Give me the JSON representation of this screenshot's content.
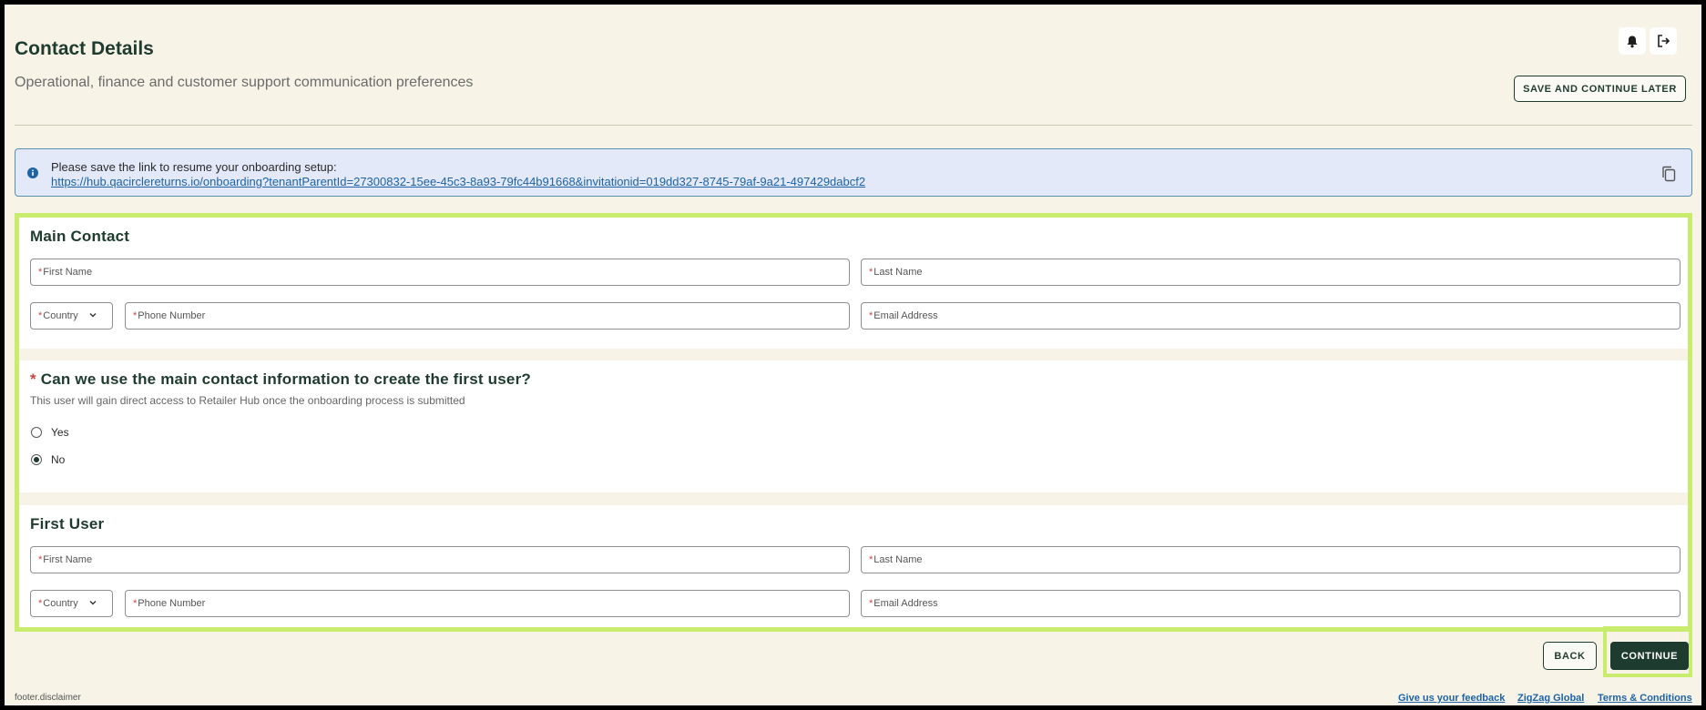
{
  "header": {
    "title": "Contact Details",
    "subtitle": "Operational, finance and customer support communication preferences",
    "save_later_label": "SAVE AND CONTINUE LATER"
  },
  "icons": {
    "notifications": "bell-icon",
    "logout": "logout-icon",
    "info": "info-icon",
    "copy": "copy-icon",
    "dropdown": "chevron-down-icon"
  },
  "banner": {
    "text": "Please save the link to resume your onboarding setup:",
    "link": "https://hub.qacirclereturns.io/onboarding?tenantParentId=27300832-15ee-45c3-8a93-79fc44b91668&invitationid=019dd327-8745-79af-9a21-497429dabcf2"
  },
  "main_contact": {
    "title": "Main Contact",
    "first_name": "First Name",
    "last_name": "Last Name",
    "country": "Country",
    "phone": "Phone Number",
    "email": "Email Address"
  },
  "first_user_question": {
    "asterisk": "*",
    "question": "Can we use the main contact information to create the first user?",
    "hint": "This user will gain direct access to Retailer Hub once the onboarding process is submitted",
    "options": [
      {
        "label": "Yes",
        "selected": false
      },
      {
        "label": "No",
        "selected": true
      }
    ]
  },
  "first_user": {
    "title": "First User",
    "first_name": "First Name",
    "last_name": "Last Name",
    "country": "Country",
    "phone": "Phone Number",
    "email": "Email Address"
  },
  "required_marker": "*",
  "actions": {
    "back_label": "BACK",
    "continue_label": "CONTINUE"
  },
  "footer": {
    "disclaimer": "footer.disclaimer",
    "links": [
      "Give us your feedback",
      "ZigZag Global",
      "Terms & Conditions"
    ]
  },
  "colors": {
    "background": "#f7f3e7",
    "primary": "#1e3b2f",
    "highlight": "#c9ec6f",
    "info_bg": "#e3e9f8",
    "link": "#1d63a6",
    "required": "#d0433b"
  }
}
